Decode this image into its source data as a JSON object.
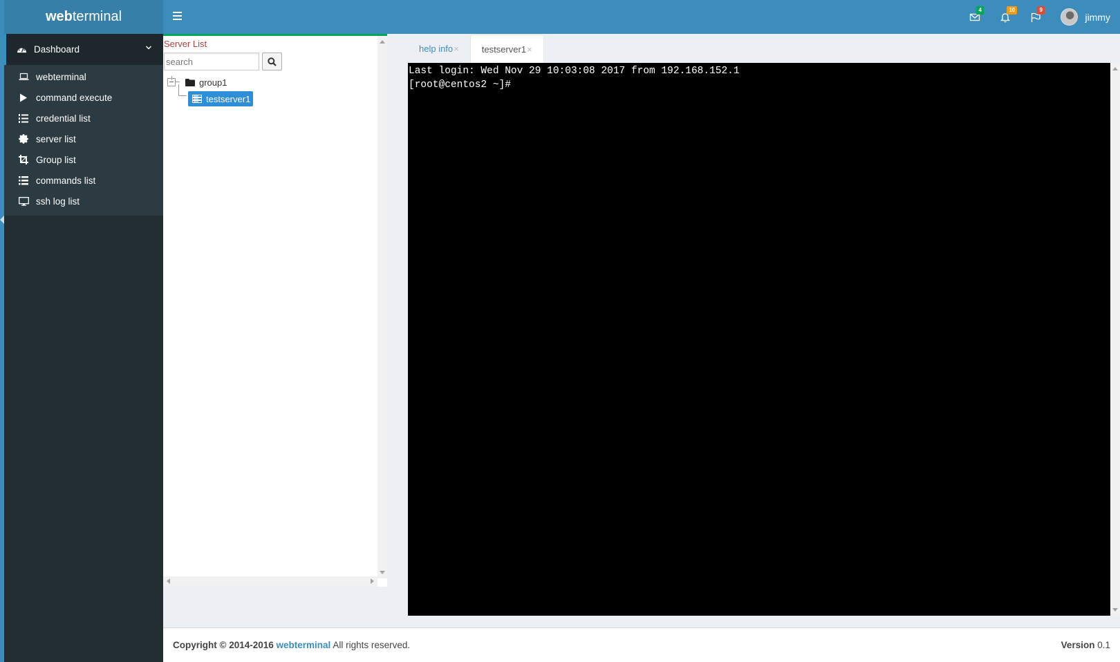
{
  "app": {
    "logo_bold": "web",
    "logo_rest": "terminal"
  },
  "header": {
    "notifications": [
      {
        "icon": "envelope-icon",
        "count": "4",
        "color": "#00a65a"
      },
      {
        "icon": "bell-icon",
        "count": "10",
        "color": "#f39c12"
      },
      {
        "icon": "flag-icon",
        "count": "9",
        "color": "#dd4b39"
      }
    ],
    "user_name": "jimmy"
  },
  "sidebar": {
    "dashboard_label": "Dashboard",
    "items": [
      {
        "label": "webterminal",
        "icon": "laptop-icon"
      },
      {
        "label": "command execute",
        "icon": "play-icon"
      },
      {
        "label": "credential list",
        "icon": "list-ol-icon"
      },
      {
        "label": "server list",
        "icon": "certificate-icon"
      },
      {
        "label": "Group list",
        "icon": "crop-icon"
      },
      {
        "label": "commands list",
        "icon": "list-icon"
      },
      {
        "label": "ssh log list",
        "icon": "desktop-icon"
      }
    ]
  },
  "server_panel": {
    "title": "Server List",
    "search_placeholder": "search",
    "tree": {
      "group": "group1",
      "servers": [
        "testserver1"
      ]
    }
  },
  "tabs": [
    {
      "label": "help info",
      "close": "×",
      "active": false
    },
    {
      "label": "testserver1",
      "close": "×",
      "active": true
    }
  ],
  "terminal": {
    "lines": [
      "Last login: Wed Nov 29 10:03:08 2017 from 192.168.152.1",
      "[root@centos2 ~]#"
    ]
  },
  "footer": {
    "copyright_prefix": "Copyright © 2014-2016",
    "brand_link": "webterminal",
    "rights": "All rights reserved.",
    "version_label": "Version",
    "version_value": "0.1"
  },
  "colors": {
    "header": "#3c8dbc",
    "sidebar": "#222d32",
    "accent_green": "#00a65a"
  }
}
